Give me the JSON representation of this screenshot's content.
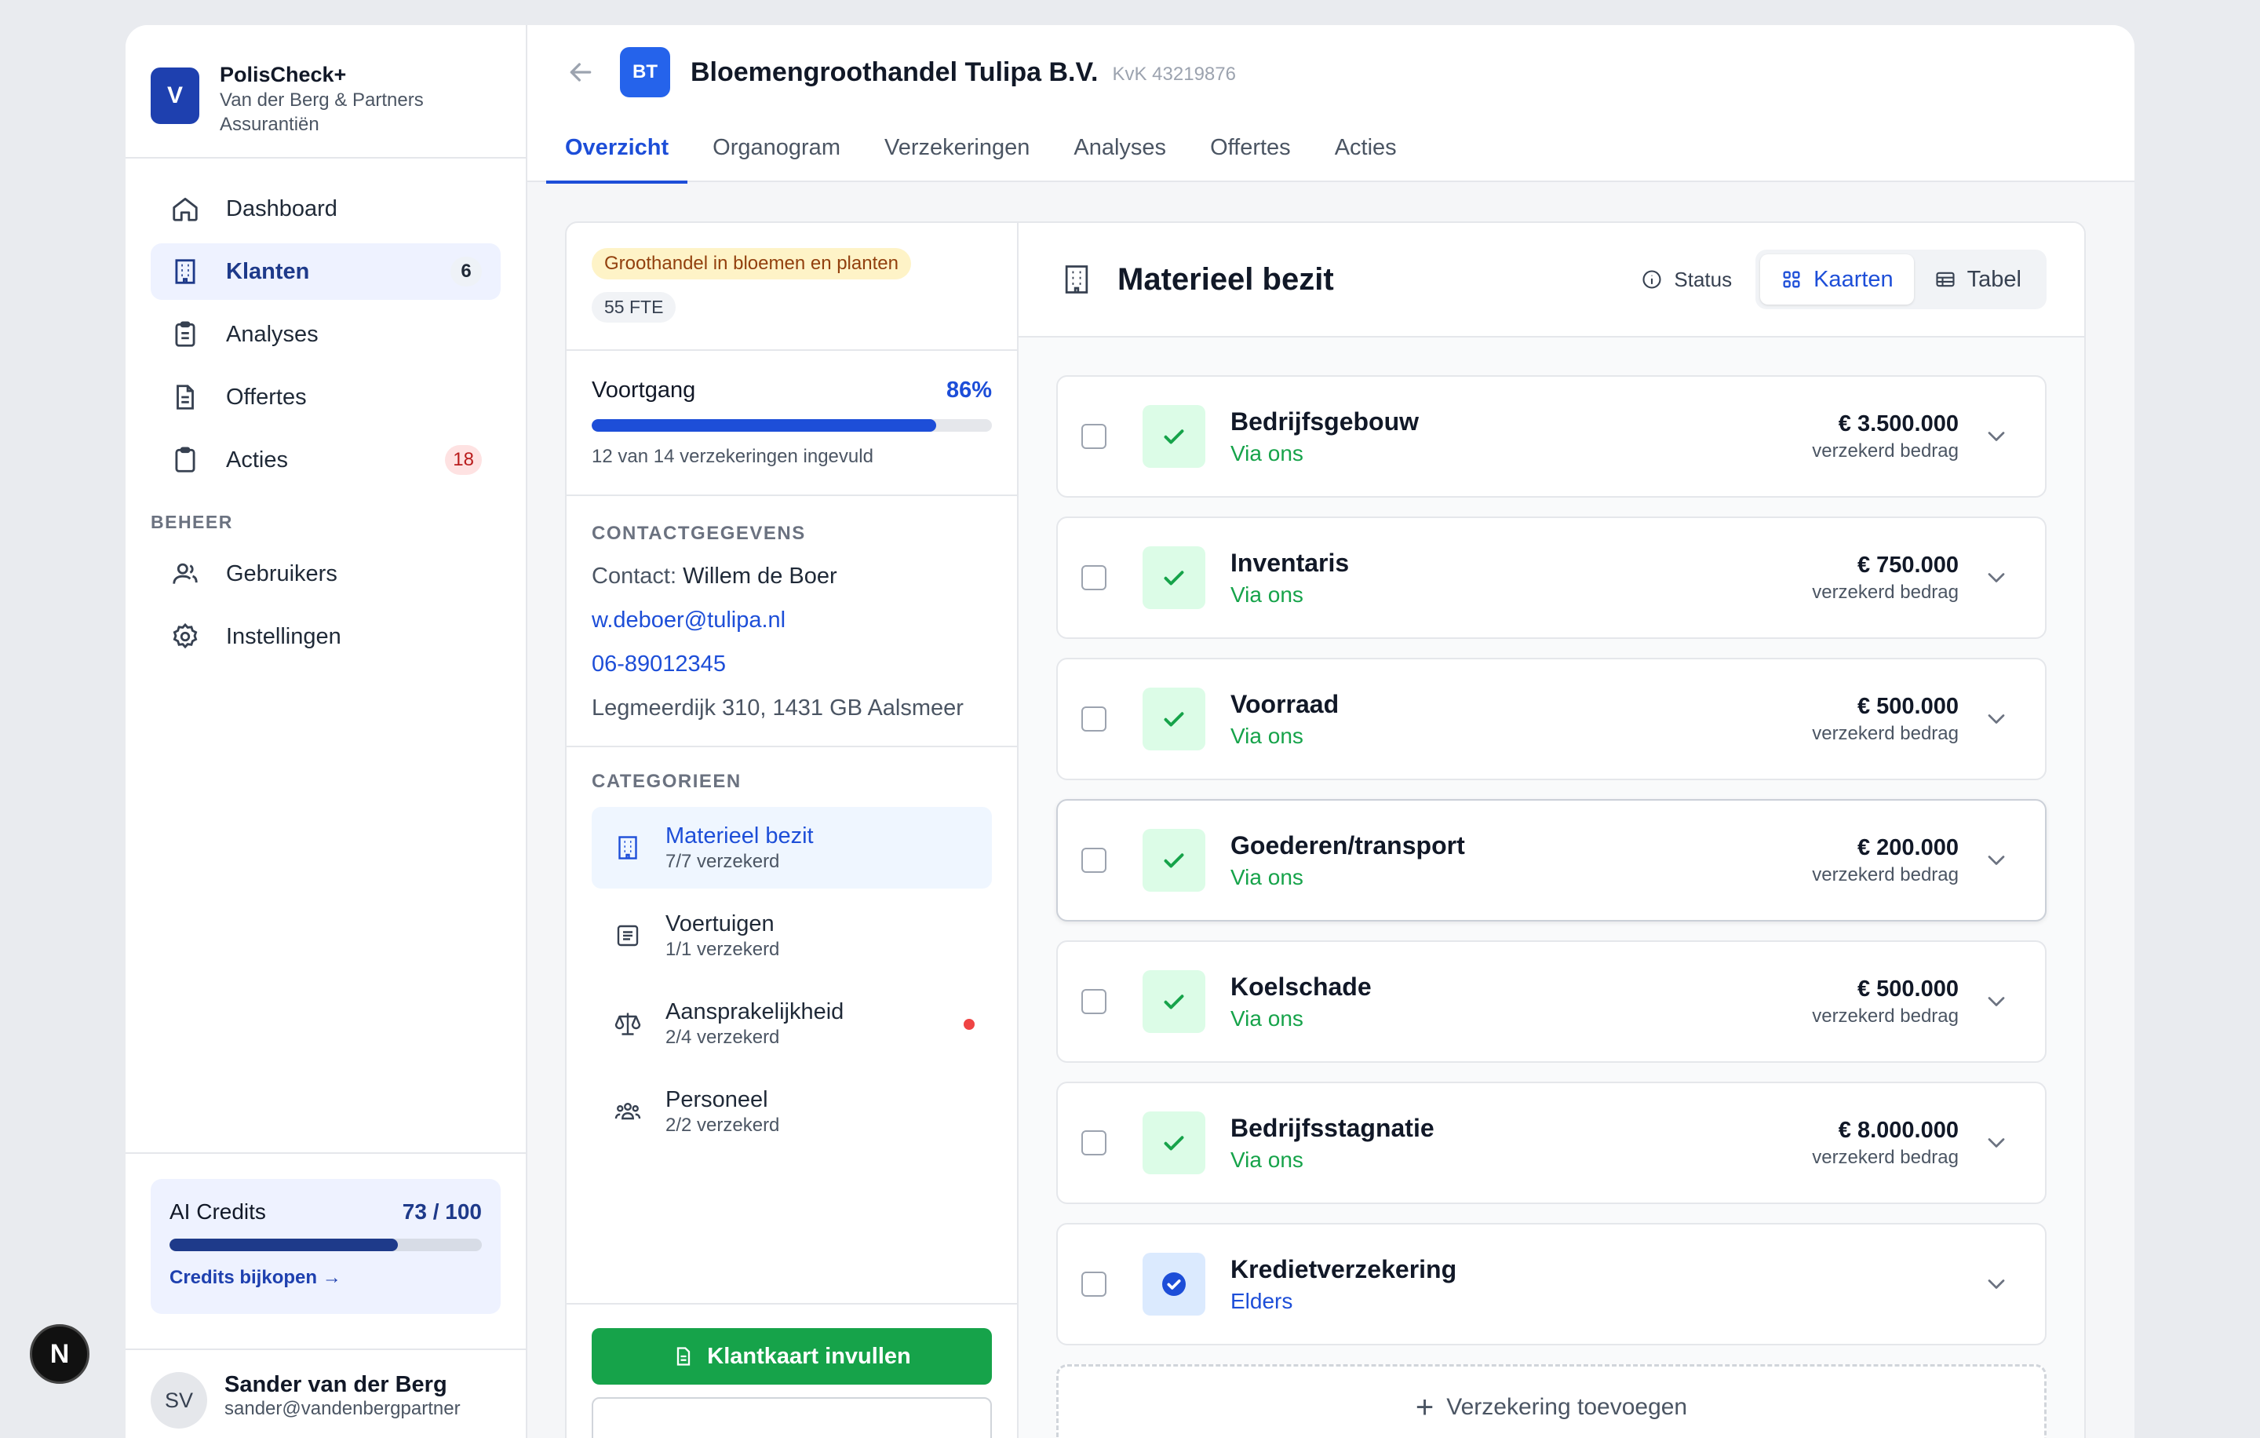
{
  "brand": {
    "initial": "V",
    "name": "PolisCheck+",
    "subtitle": "Van der Berg & Partners Assurantiën"
  },
  "nav": [
    {
      "label": "Dashboard",
      "icon": "home-icon",
      "badge": null
    },
    {
      "label": "Klanten",
      "icon": "building-icon",
      "badge": "6",
      "active": true
    },
    {
      "label": "Analyses",
      "icon": "clipboard-check-icon",
      "badge": null
    },
    {
      "label": "Offertes",
      "icon": "document-icon",
      "badge": null
    },
    {
      "label": "Acties",
      "icon": "clipboard-icon",
      "badge": "18"
    }
  ],
  "beheer": {
    "title": "BEHEER",
    "items": [
      {
        "label": "Gebruikers",
        "icon": "users-icon"
      },
      {
        "label": "Instellingen",
        "icon": "gear-icon"
      }
    ]
  },
  "credits": {
    "label": "AI Credits",
    "value": "73 / 100",
    "fraction": 0.73,
    "link": "Credits bijkopen →"
  },
  "user": {
    "initials": "SV",
    "name": "Sander van der Berg",
    "email": "sander@vandenbergpartner"
  },
  "client": {
    "initials": "BT",
    "name": "Bloemengroothandel Tulipa B.V.",
    "kvk": "KvK 43219876"
  },
  "tabs": [
    "Overzicht",
    "Organogram",
    "Verzekeringen",
    "Analyses",
    "Offertes",
    "Acties"
  ],
  "profile": {
    "industry": "Groothandel in bloemen en planten",
    "fte": "55 FTE"
  },
  "progress": {
    "label": "Voortgang",
    "percent": "86%",
    "fraction": 0.86,
    "sub": "12 van 14 verzekeringen ingevuld"
  },
  "contact": {
    "title": "CONTACTGEGEVENS",
    "contact_prefix": "Contact:",
    "contact_name": "Willem de Boer",
    "email": "w.deboer@tulipa.nl",
    "phone": "06-89012345",
    "address": "Legmeerdijk 310, 1431 GB Aalsmeer"
  },
  "categories": {
    "title": "CATEGORIEEN",
    "items": [
      {
        "name": "Materieel bezit",
        "sub": "7/7 verzekerd",
        "icon": "building-icon",
        "active": true
      },
      {
        "name": "Voertuigen",
        "sub": "1/1 verzekerd",
        "icon": "list-icon"
      },
      {
        "name": "Aansprakelijkheid",
        "sub": "2/4 verzekerd",
        "icon": "scale-icon",
        "alert": true
      },
      {
        "name": "Personeel",
        "sub": "2/2 verzekerd",
        "icon": "team-icon"
      }
    ]
  },
  "actions": {
    "fill_button": "Klantkaart invullen"
  },
  "section": {
    "title": "Materieel bezit",
    "status_label": "Status",
    "view_cards": "Kaarten",
    "view_table": "Tabel"
  },
  "amount_label": "verzekerd bedrag",
  "insurances": [
    {
      "name": "Bedrijfsgebouw",
      "source": "Via ons",
      "amount": "€ 3.500.000",
      "status": "ok"
    },
    {
      "name": "Inventaris",
      "source": "Via ons",
      "amount": "€ 750.000",
      "status": "ok"
    },
    {
      "name": "Voorraad",
      "source": "Via ons",
      "amount": "€ 500.000",
      "status": "ok"
    },
    {
      "name": "Goederen/transport",
      "source": "Via ons",
      "amount": "€ 200.000",
      "status": "ok"
    },
    {
      "name": "Koelschade",
      "source": "Via ons",
      "amount": "€ 500.000",
      "status": "ok"
    },
    {
      "name": "Bedrijfsstagnatie",
      "source": "Via ons",
      "amount": "€ 8.000.000",
      "status": "ok"
    },
    {
      "name": "Kredietverzekering",
      "source": "Elders",
      "amount": "",
      "status": "elsewhere"
    }
  ],
  "add_label": "Verzekering toevoegen",
  "next_badge": "N",
  "colors": {
    "primary": "#1d4ed8",
    "green": "#16a34a",
    "red": "#ef4444",
    "navy": "#1e3a8a"
  }
}
